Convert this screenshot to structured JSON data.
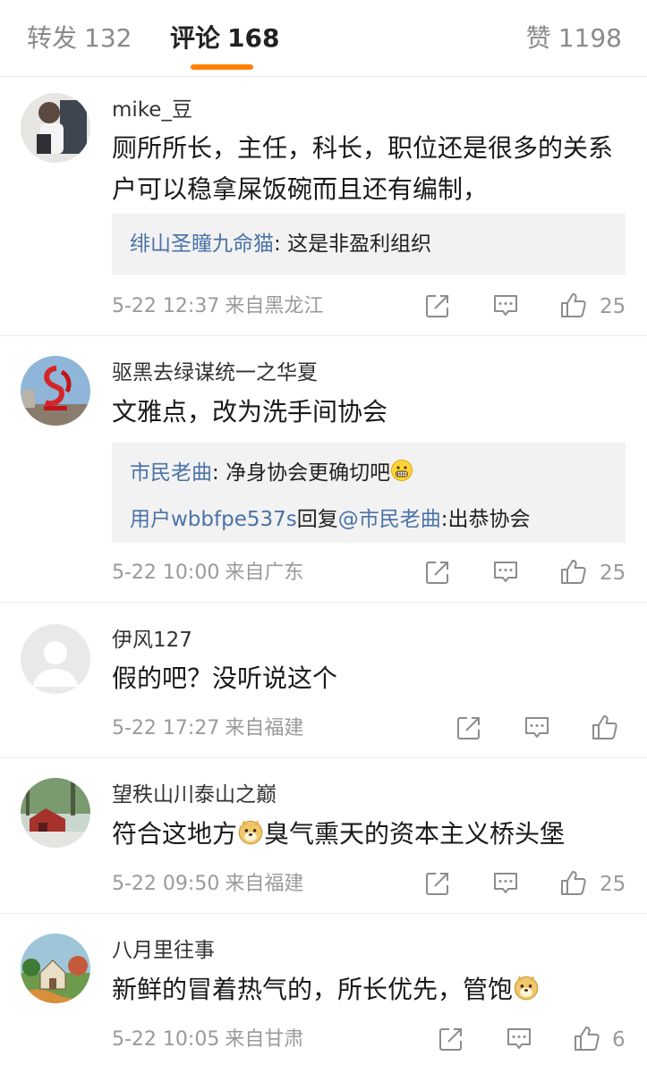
{
  "tabs": {
    "repost": {
      "label": "转发",
      "count": "132"
    },
    "comments": {
      "label": "评论",
      "count": "168"
    },
    "likes": {
      "label": "赞",
      "count": "1198"
    }
  },
  "colors": {
    "accent": "#ff8200",
    "link": "#4a73a8",
    "reply_bg": "#f2f2f2"
  },
  "comments": [
    {
      "user": "mike_豆",
      "text": "厕所所长，主任，科长，职位还是很多的关系户可以稳拿屎饭碗而且还有编制，",
      "replies": [
        {
          "user": "绯山圣瞳九命猫",
          "sep": ": ",
          "text": "这是非盈利组织"
        }
      ],
      "time": "5-22 12:37",
      "source": "来自黑龙江",
      "likes": "25"
    },
    {
      "user": "驱黑去绿谋统一之华夏",
      "text": "文雅点，改为洗手间协会",
      "replies": [
        {
          "user": "市民老曲",
          "sep": ": ",
          "text": "净身协会更确切吧",
          "emoji": "grin-emoji"
        },
        {
          "user": "用户wbbfpe537s",
          "mid": "回复",
          "mention": "@市民老曲",
          "sep": ":",
          "text": "出恭协会"
        }
      ],
      "time": "5-22 10:00",
      "source": "来自广东",
      "likes": "25"
    },
    {
      "user": "伊风127",
      "text": "假的吧？没听说这个",
      "time": "5-22 17:27",
      "source": "来自福建",
      "likes": ""
    },
    {
      "user": "望秩山川泰山之巅",
      "text_before": "符合这地方",
      "emoji": "doge-emoji",
      "text_after": "臭气熏天的资本主义桥头堡",
      "time": "5-22 09:50",
      "source": "来自福建",
      "likes": "25"
    },
    {
      "user": "八月里往事",
      "text_before": "新鲜的冒着热气的，所长优先，管饱",
      "emoji": "doge-emoji",
      "text_after": "",
      "time": "5-22 10:05",
      "source": "来自甘肃",
      "likes": "6"
    }
  ]
}
